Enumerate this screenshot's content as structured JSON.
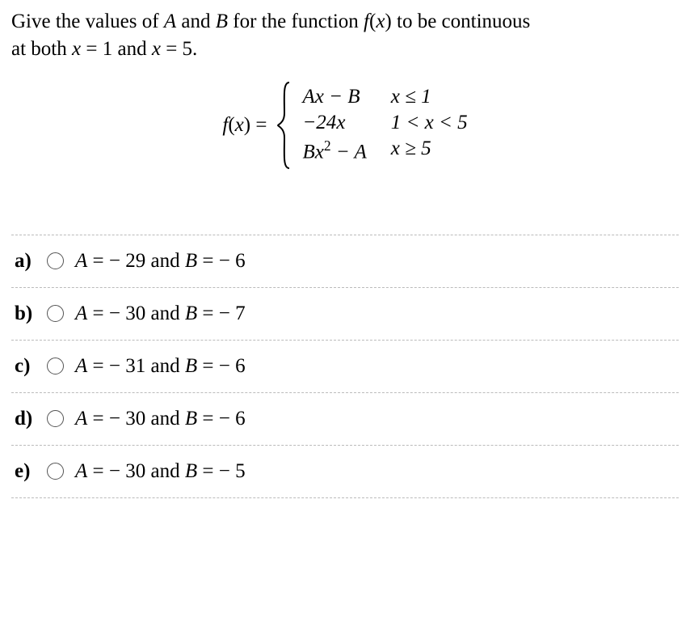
{
  "question": {
    "line1_prefix": "Give the values of ",
    "A": "A",
    "and1": " and ",
    "B": "B",
    "mid1": " for the function ",
    "fx": "f",
    "paren_open": "(",
    "x": "x",
    "paren_close": ")",
    "mid2": " to be continuous",
    "line2_prefix": "at both ",
    "eq1_lhs": "x",
    "eq1_rhs": " = 1",
    "and2": " and ",
    "eq2_lhs": "x",
    "eq2_rhs": " = 5",
    "period": "."
  },
  "formula": {
    "lhs_f": "f",
    "lhs_x": "x",
    "equals": " = ",
    "cases": [
      {
        "expr_A": "Ax",
        "expr_op": " − ",
        "expr_B": "B",
        "cond_var": "x",
        "cond_rel": " ≤ 1"
      },
      {
        "expr_coef": "−24",
        "expr_x": "x",
        "cond": "1 < x < 5",
        "cond_var": "x"
      },
      {
        "expr_B": "Bx",
        "expr_sup": "2",
        "expr_op": " − ",
        "expr_A": "A",
        "cond_var": "x",
        "cond_rel": " ≥ 5"
      }
    ]
  },
  "options": [
    {
      "label": "a)",
      "A_val": "− 29",
      "B_val": "− 6"
    },
    {
      "label": "b)",
      "A_val": "− 30",
      "B_val": "− 7"
    },
    {
      "label": "c)",
      "A_val": "− 31",
      "B_val": "− 6"
    },
    {
      "label": "d)",
      "A_val": "− 30",
      "B_val": "− 6"
    },
    {
      "label": "e)",
      "A_val": "− 30",
      "B_val": "− 5"
    }
  ],
  "strings": {
    "A_eq": "A",
    "equals": " = ",
    "and": " and ",
    "B_eq": "B"
  }
}
